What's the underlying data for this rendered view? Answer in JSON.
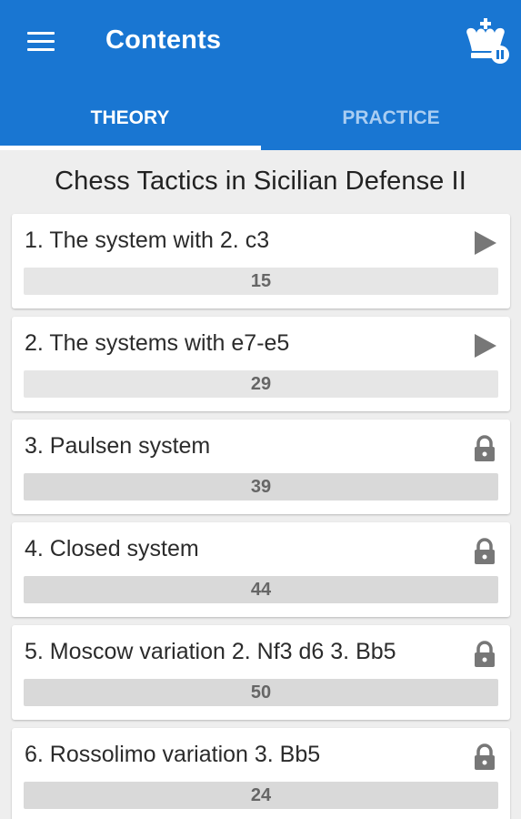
{
  "header": {
    "title": "Contents",
    "menu_icon": "hamburger-menu-icon",
    "logo_icon": "chess-king-logo-icon",
    "color": "#1976d2"
  },
  "tabs": [
    {
      "label": "THEORY",
      "active": true
    },
    {
      "label": "PRACTICE",
      "active": false
    }
  ],
  "course_title": "Chess Tactics in Sicilian Defense II",
  "chapters": [
    {
      "title": "1. The system with 2. c3",
      "count": "15",
      "status": "play",
      "progress": 0
    },
    {
      "title": "2. The systems with e7-e5",
      "count": "29",
      "status": "play",
      "progress": 0
    },
    {
      "title": "3. Paulsen system",
      "count": "39",
      "status": "locked",
      "progress": 0
    },
    {
      "title": "4. Closed system",
      "count": "44",
      "status": "locked",
      "progress": 0
    },
    {
      "title": "5. Moscow variation 2. Nf3 d6 3. Bb5",
      "count": "50",
      "status": "locked",
      "progress": 0
    },
    {
      "title": "6. Rossolimo variation 3. Bb5",
      "count": "24",
      "status": "locked",
      "progress": 0
    }
  ]
}
